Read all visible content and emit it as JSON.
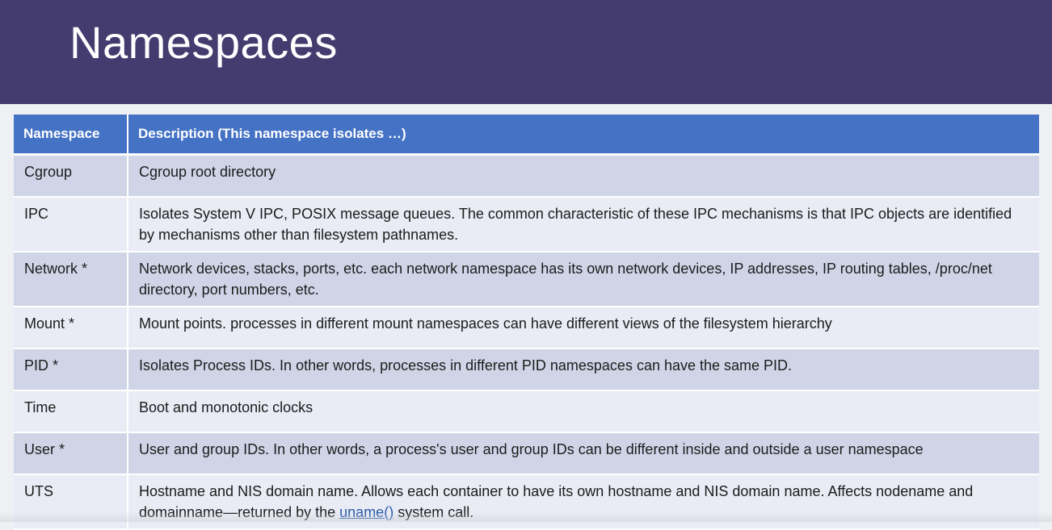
{
  "slide": {
    "title": "Namespaces"
  },
  "table": {
    "headers": [
      "Namespace",
      "Description (This namespace isolates …)"
    ],
    "rows": [
      {
        "name": "Cgroup",
        "desc": "Cgroup root directory"
      },
      {
        "name": "IPC",
        "desc": "Isolates System V IPC, POSIX message queues. The common characteristic of these IPC mechanisms is that IPC objects are identified by mechanisms other than filesystem pathnames."
      },
      {
        "name": "Network *",
        "desc": "Network devices, stacks, ports, etc. each network namespace has its own network devices, IP addresses, IP routing tables, /proc/net directory, port numbers, etc."
      },
      {
        "name": "Mount *",
        "desc": "Mount points. processes in different mount namespaces can have different views of the filesystem hierarchy"
      },
      {
        "name": "PID *",
        "desc": "Isolates Process IDs. In other words, processes in different PID namespaces can have the same PID."
      },
      {
        "name": "Time",
        "desc": "Boot and monotonic clocks"
      },
      {
        "name": "User *",
        "desc": "User and group IDs. In other words, a process's user and group IDs can be different inside and outside a user namespace"
      },
      {
        "name": "UTS",
        "desc_before": "Hostname and NIS domain name. Allows each container to have its own hostname and NIS domain name. Affects nodename and domainname—returned by the ",
        "desc_link": "uname()",
        "desc_after": " system call."
      }
    ]
  },
  "colors": {
    "title_bar": "#443c6e",
    "header": "#4472c4",
    "row_odd": "#cfd5e7",
    "row_even": "#e9ebf5",
    "link": "#2458a8"
  }
}
